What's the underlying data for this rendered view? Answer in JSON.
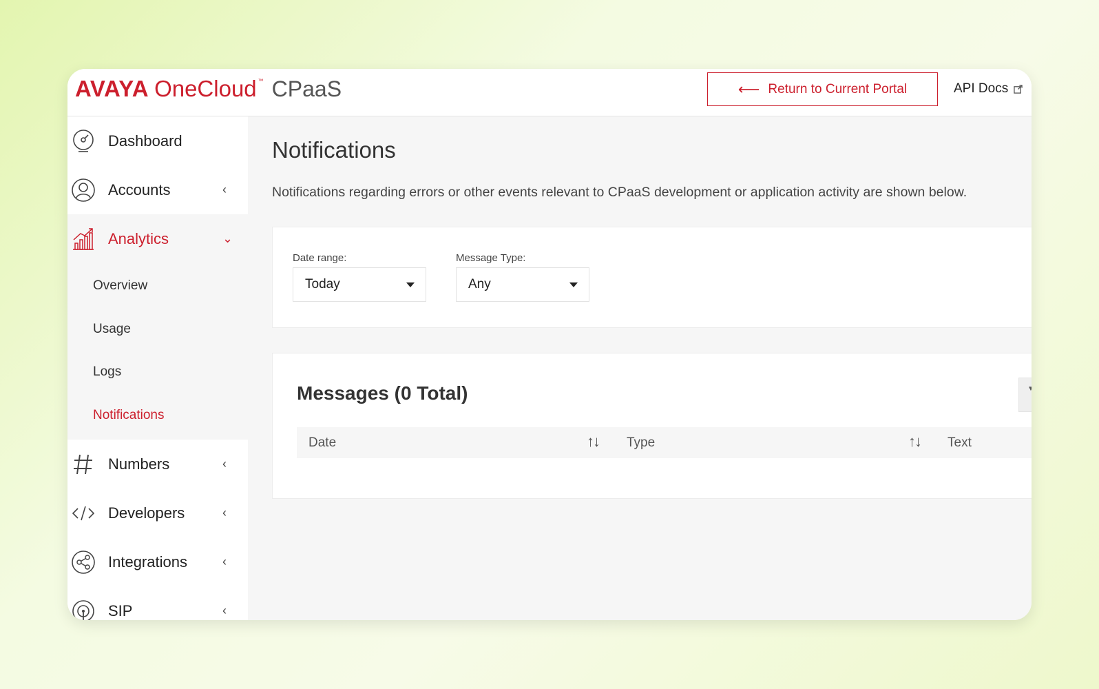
{
  "header": {
    "logo_avaya": "AVAYA",
    "logo_onecloud": "OneCloud",
    "logo_tm": "™",
    "logo_cpaas": "CPaaS",
    "return_arrow": "⟵",
    "return_label": "Return to Current Portal",
    "api_docs_label": "API Docs"
  },
  "sidebar": {
    "items": [
      {
        "label": "Dashboard",
        "icon": "dashboard-gauge-icon"
      },
      {
        "label": "Accounts",
        "icon": "account-user-icon",
        "chevron": "‹"
      },
      {
        "label": "Analytics",
        "icon": "analytics-chart-icon",
        "chevron": "⌄",
        "active": true
      },
      {
        "label": "Numbers",
        "icon": "hash-icon",
        "chevron": "‹"
      },
      {
        "label": "Developers",
        "icon": "code-icon",
        "chevron": "‹"
      },
      {
        "label": "Integrations",
        "icon": "share-network-icon",
        "chevron": "‹"
      },
      {
        "label": "SIP",
        "icon": "sip-antenna-icon",
        "chevron": "‹"
      }
    ],
    "analytics_sub": [
      "Overview",
      "Usage",
      "Logs",
      "Notifications"
    ]
  },
  "main": {
    "title": "Notifications",
    "description": "Notifications regarding errors or other events relevant to CPaaS development or application activity are shown below.",
    "filters": {
      "date_range_label": "Date range:",
      "date_range_value": "Today",
      "message_type_label": "Message Type:",
      "message_type_value": "Any"
    },
    "messages": {
      "title": "Messages (0 Total)",
      "columns": [
        "Date",
        "Type",
        "Text"
      ],
      "sort_glyph": "↑↓",
      "filter_glyph": "▼"
    }
  },
  "colors": {
    "brand_red": "#cc1f2d",
    "sidebar_active_bg": "#f6f6f6",
    "main_bg": "#f6f6f6"
  }
}
